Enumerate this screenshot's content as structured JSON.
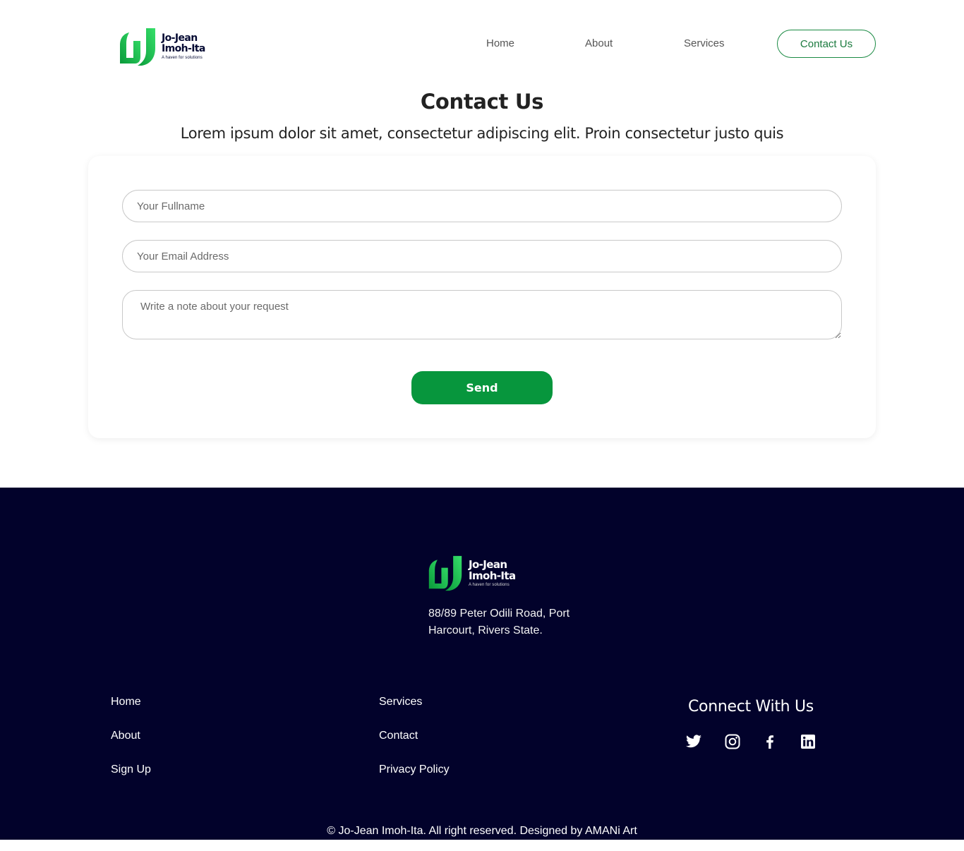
{
  "brand": {
    "name_line1": "Jo-Jean",
    "name_line2": "Imoh-Ita",
    "tagline": "A haven for solutions",
    "logo_icon": "leaf-logo-icon",
    "colors": {
      "green": "#07963d",
      "green_light": "#2bd65a",
      "navy": "#02022b"
    }
  },
  "nav": {
    "home": "Home",
    "about": "About",
    "services": "Services",
    "contact": "Contact Us"
  },
  "hero": {
    "title": "Contact Us",
    "subtitle": "Lorem ipsum dolor sit amet, consectetur adipiscing elit. Proin consectetur justo quis"
  },
  "form": {
    "fullname_placeholder": "Your Fullname",
    "email_placeholder": "Your Email Address",
    "note_placeholder": "Write a note about your request",
    "send_label": "Send"
  },
  "footer": {
    "address_line1": "88/89 Peter Odili Road, Port",
    "address_line2": "Harcourt, Rivers State.",
    "links_col1": [
      "Home",
      "About",
      "Sign Up"
    ],
    "links_col2": [
      "Services",
      "Contact",
      "Privacy Policy"
    ],
    "connect_title": "Connect With Us",
    "social_icons": [
      "twitter-icon",
      "instagram-icon",
      "facebook-icon",
      "linkedin-icon"
    ],
    "copyright": "© Jo-Jean Imoh-Ita. All right reserved. Designed by AMANi Art"
  }
}
